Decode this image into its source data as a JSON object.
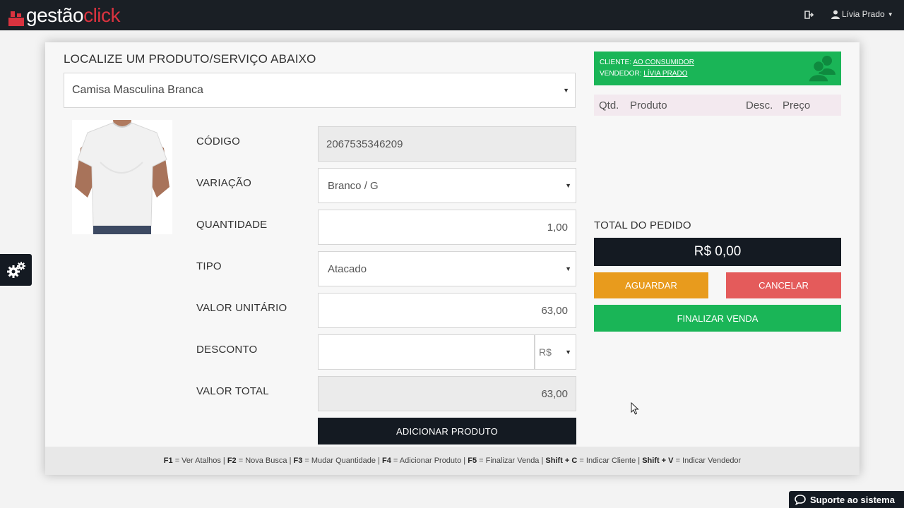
{
  "brand": {
    "part1": "gestão",
    "part2": "click",
    "accent": "#d9333f"
  },
  "nav": {
    "user_name": "Lívia Prado",
    "exit_icon": "sign-out-icon",
    "user_icon": "user-icon"
  },
  "search": {
    "title": "LOCALIZE UM PRODUTO/SERVIÇO ABAIXO",
    "value": "Camisa Masculina Branca"
  },
  "form": {
    "code_label": "CÓDIGO",
    "code_value": "2067535346209",
    "variation_label": "VARIAÇÃO",
    "variation_value": "Branco / G",
    "quantity_label": "QUANTIDADE",
    "quantity_value": "1,00",
    "type_label": "TIPO",
    "type_value": "Atacado",
    "unit_value_label": "VALOR UNITÁRIO",
    "unit_value": "63,00",
    "discount_label": "DESCONTO",
    "discount_value": "",
    "discount_unit": "R$",
    "total_label": "VALOR TOTAL",
    "total_value": "63,00",
    "add_button": "ADICIONAR PRODUTO"
  },
  "order": {
    "client_prefix": "CLIENTE:",
    "client_name": "AO CONSUMIDOR",
    "seller_prefix": "VENDEDOR:",
    "seller_name": "LÍVIA PRADO",
    "columns": {
      "qty": "Qtd.",
      "product": "Produto",
      "discount": "Desc.",
      "price": "Preço"
    },
    "total_label": "TOTAL DO PEDIDO",
    "total_value": "R$ 0,00",
    "wait_button": "AGUARDAR",
    "cancel_button": "CANCELAR",
    "finish_button": "FINALIZAR VENDA"
  },
  "shortcuts": [
    {
      "key": "F1",
      "text": "= Ver Atalhos"
    },
    {
      "key": "F2",
      "text": "= Nova Busca"
    },
    {
      "key": "F3",
      "text": "= Mudar Quantidade"
    },
    {
      "key": "F4",
      "text": "= Adicionar Produto"
    },
    {
      "key": "F5",
      "text": "= Finalizar Venda"
    },
    {
      "key": "Shift + C",
      "text": "= Indicar Cliente"
    },
    {
      "key": "Shift + V",
      "text": "= Indicar Vendedor"
    }
  ],
  "support": {
    "label": "Suporte ao sistema"
  },
  "colors": {
    "dark": "#141a22",
    "green": "#1ab557",
    "orange": "#e89b1d",
    "red": "#e45b5b"
  }
}
